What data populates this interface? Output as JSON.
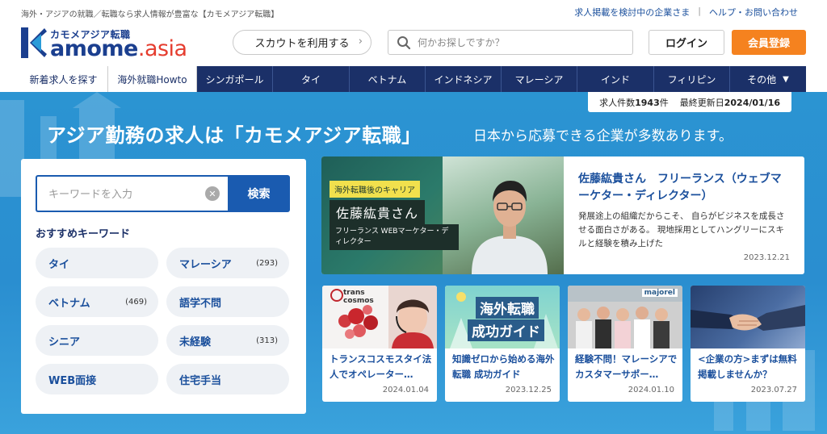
{
  "header": {
    "tagline": "海外・アジアの就職／転職なら求人情報が豊富な【カモメアジア転職】",
    "links": [
      "求人掲載を検討中の企業さま",
      "ヘルプ・お問い合わせ"
    ],
    "link_separator": "|",
    "logo": {
      "sub": "カモメアジア転職",
      "main": "amome",
      "suffix": ".asia"
    },
    "scout_label": "スカウトを利用する",
    "search_placeholder": "何かお探しですか？",
    "login_label": "ログイン",
    "register_label": "会員登録"
  },
  "nav": {
    "items": [
      "新着求人を探す",
      "海外就職Howto",
      "シンガポール",
      "タイ",
      "ベトナム",
      "インドネシア",
      "マレーシア",
      "インド",
      "フィリピン",
      "その他"
    ]
  },
  "stats": {
    "count_label": "求人件数",
    "count_value": "1943",
    "count_unit": "件",
    "updated_label": "最終更新日",
    "updated_value": "2024/01/16"
  },
  "hero": {
    "title": "アジア勤務の求人は「カモメアジア転職」",
    "subtitle": "日本から応募できる企業が多数あります。"
  },
  "search_panel": {
    "placeholder": "キーワードを入力",
    "button_label": "検索",
    "heading": "おすすめキーワード",
    "keywords": [
      {
        "label": "タイ",
        "count": ""
      },
      {
        "label": "マレーシア",
        "count": "(293)"
      },
      {
        "label": "ベトナム",
        "count": "(469)"
      },
      {
        "label": "語学不問",
        "count": ""
      },
      {
        "label": "シニア",
        "count": ""
      },
      {
        "label": "未経験",
        "count": "(313)"
      },
      {
        "label": "WEB面接",
        "count": ""
      },
      {
        "label": "住宅手当",
        "count": ""
      }
    ]
  },
  "feature": {
    "tag": "海外転職後のキャリア",
    "name": "佐藤紘貴さん",
    "role": "フリーランス WEBマーケター・ディレクター",
    "title": "佐藤紘貴さん　フリーランス（ウェブマーケター・ディレクター）",
    "desc": "発展途上の組織だからこそ、 自らがビジネスを成長させる面白さがある。 現地採用としてハングリーにスキルと経験を積み上げた",
    "date": "2023.12.21"
  },
  "cards": [
    {
      "title": "トランスコスモスタイ法人でオペレーター…",
      "date": "2024.01.04",
      "logo_text": "trans cosmos"
    },
    {
      "title": "知識ゼロから始める海外転職 成功ガイド",
      "date": "2023.12.25",
      "banner_line1": "海外転職",
      "banner_line2": "成功ガイド"
    },
    {
      "title": "経験不問！マレーシアでカスタマーサポー…",
      "date": "2024.01.10",
      "logo_text": "majorel"
    },
    {
      "title": "<企業の方>まずは無料掲載しませんか？",
      "date": "2023.07.27"
    }
  ]
}
